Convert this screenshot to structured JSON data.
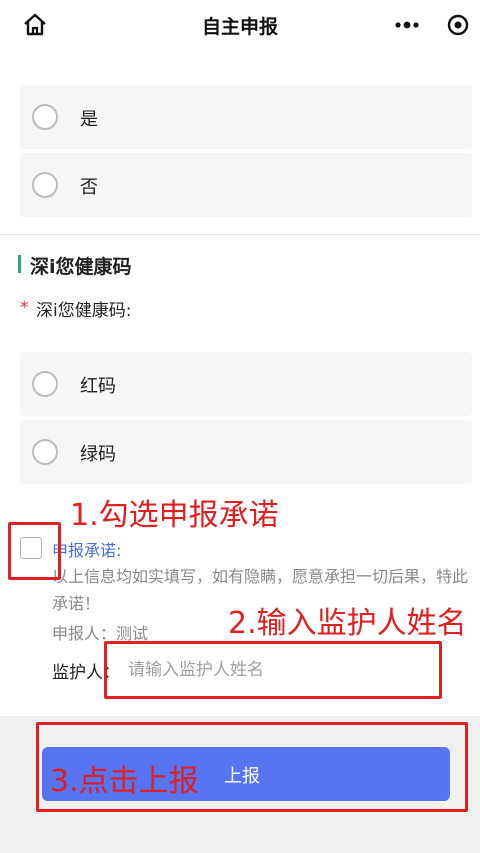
{
  "header": {
    "title": "自主申报",
    "icons": [
      "home-icon",
      "more-icon",
      "capsule-close-icon"
    ]
  },
  "question1": {
    "options": [
      "是",
      "否"
    ]
  },
  "health_code": {
    "section_title": "深i您健康码",
    "required_mark": "*",
    "field_label": "深i您健康码:",
    "options": [
      "红码",
      "绿码"
    ]
  },
  "promise": {
    "title": "申报承诺:",
    "text": "以上信息均如实填写，如有隐瞒，愿意承担一切后果，特此承诺！",
    "reporter": "申报人：测试",
    "checked": false
  },
  "guardian": {
    "label": "监护人：",
    "placeholder": "请输入监护人姓名",
    "value": ""
  },
  "submit": {
    "label": "上报"
  },
  "annotations": {
    "step1": "1.勾选申报承诺",
    "step2": "2.输入监护人姓名",
    "step3": "3.点击上报",
    "color": "#e02020"
  },
  "colors": {
    "accent": "#5774f2",
    "section_bar": "#2aa58a",
    "link": "#4a6fd6",
    "required": "#e0353b"
  }
}
